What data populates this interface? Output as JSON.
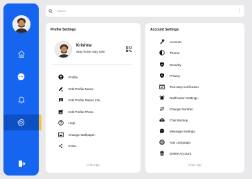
{
  "search": {
    "placeholder": "Search"
  },
  "profile_settings": {
    "title": "Profile Settings",
    "name": "Krishna",
    "status": "Stay home stay safe",
    "items": [
      {
        "label": "Profile.",
        "icon": "user-circle-icon"
      },
      {
        "label": "Edit Profile Name.",
        "icon": "pencil-icon"
      },
      {
        "label": "Edit Profile Status Info.",
        "icon": "chat-bubble-icon"
      },
      {
        "label": "Edit Profile Photo.",
        "icon": "photo-edit-icon"
      },
      {
        "label": "Help.",
        "icon": "help-icon"
      },
      {
        "label": "Change Wallpaper.",
        "icon": "wallpaper-icon"
      },
      {
        "label": "Invite.",
        "icon": "share-icon"
      }
    ],
    "footer": "Chat App"
  },
  "account_settings": {
    "title": "Account Settings",
    "items": [
      {
        "label": "Account.",
        "icon": "key-icon"
      },
      {
        "label": "Theme.",
        "icon": "theme-icon"
      },
      {
        "label": "Security.",
        "icon": "security-icon"
      },
      {
        "label": "Privacy.",
        "icon": "privacy-shield-icon"
      },
      {
        "label": "Two-step verification.",
        "icon": "verification-icon"
      },
      {
        "label": "Notification Settings.",
        "icon": "bell-icon"
      },
      {
        "label": "Change Number.",
        "icon": "swap-icon"
      },
      {
        "label": "Chat Backup.",
        "icon": "cloud-upload-icon"
      },
      {
        "label": "Message Settings.",
        "icon": "message-icon"
      },
      {
        "label": "App Language.",
        "icon": "globe-icon"
      },
      {
        "label": "Delete Account.",
        "icon": "trash-icon"
      }
    ],
    "footer": "Chat App"
  },
  "colors": {
    "sidebar": "#1565f0",
    "active_marker": "#f2c640",
    "background": "#e9e9ec"
  }
}
